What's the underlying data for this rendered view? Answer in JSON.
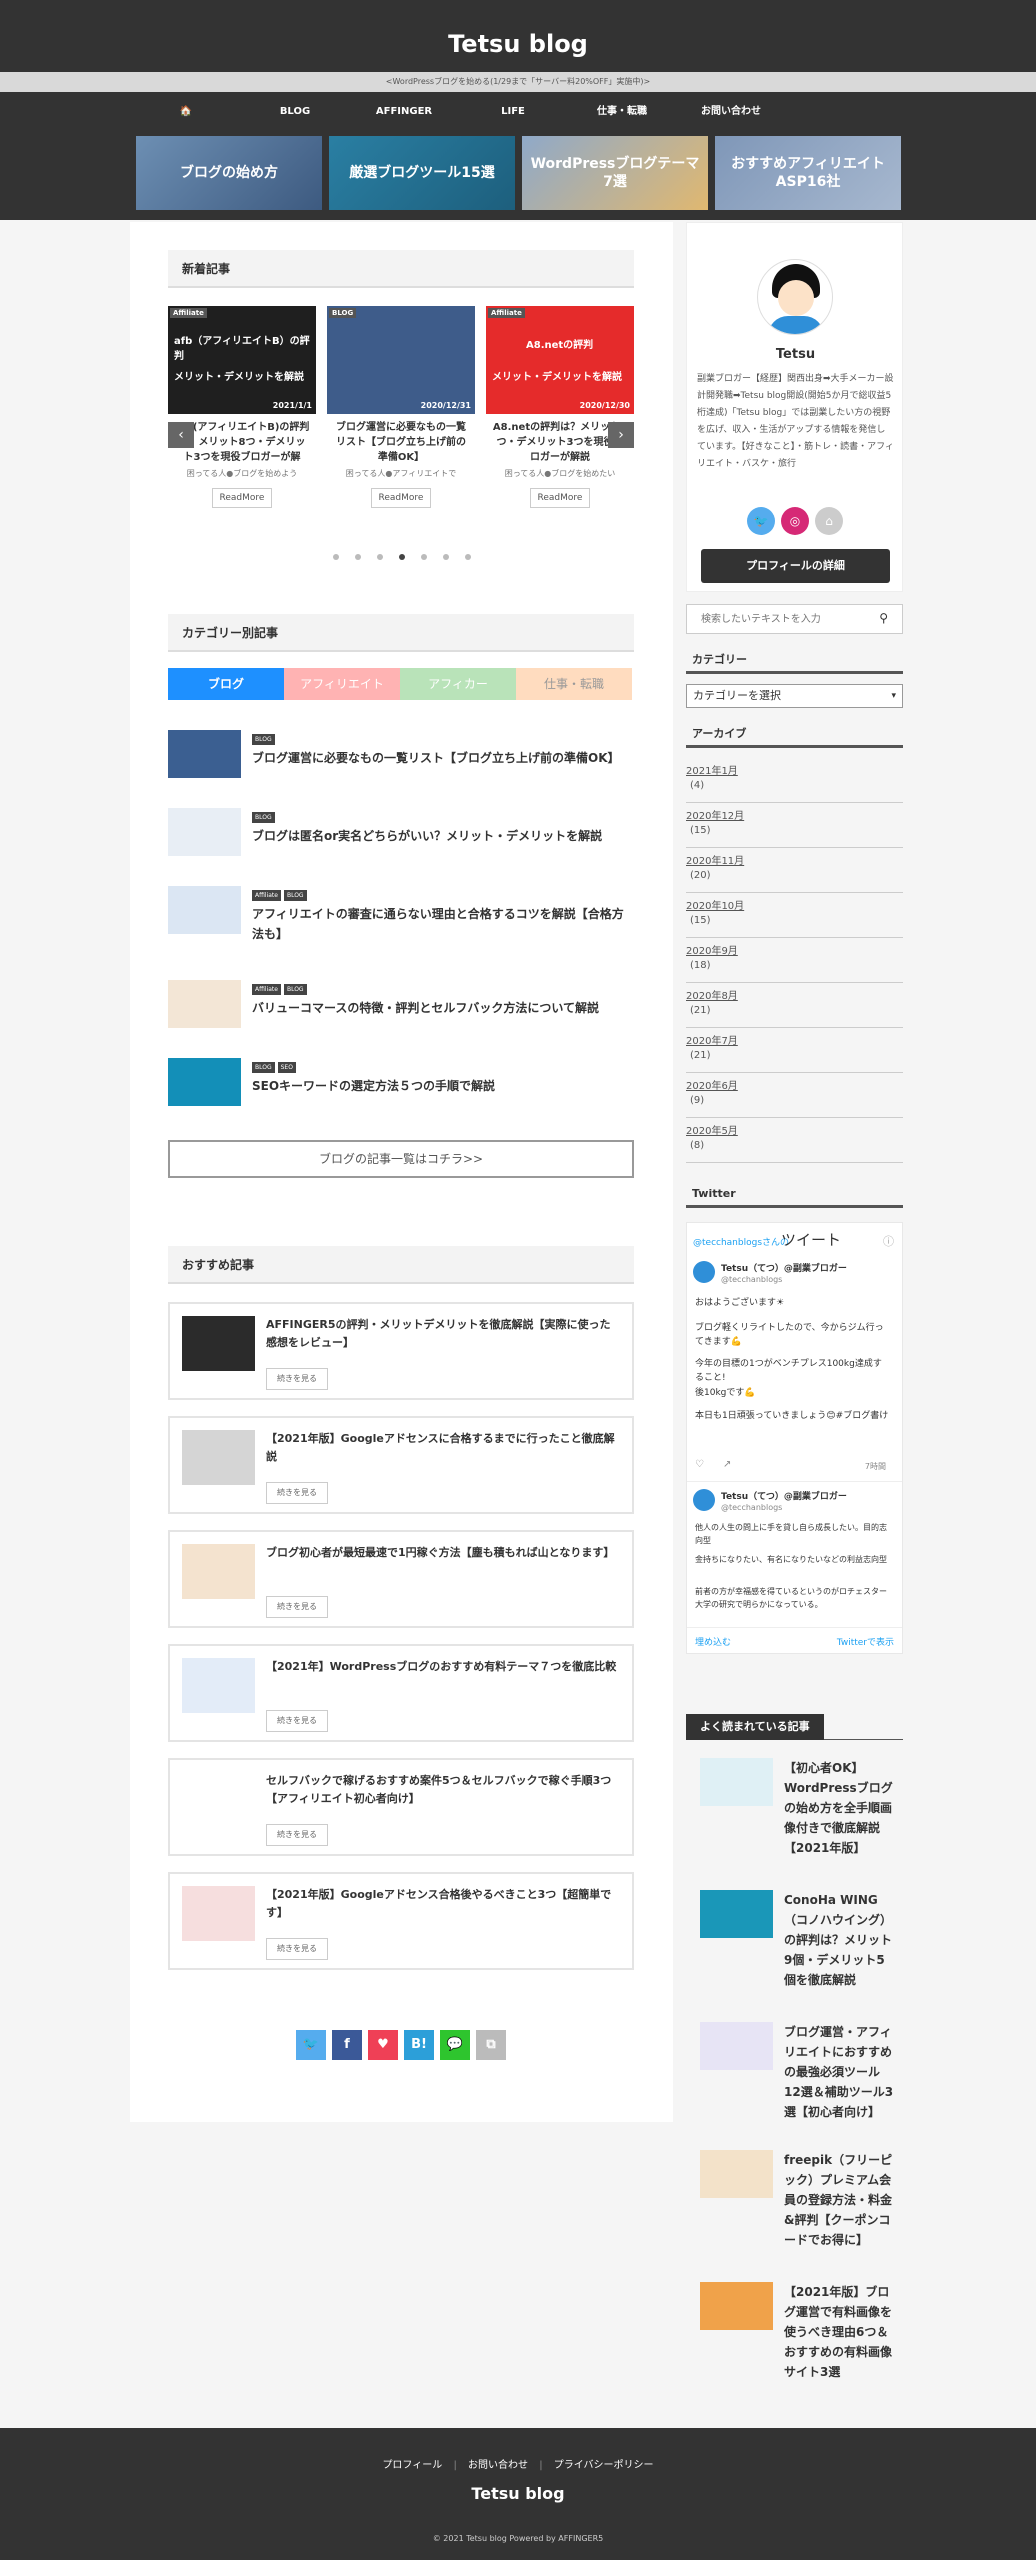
{
  "header": {
    "site_title": "Tetsu blog",
    "announcement": "<WordPressブログを始める(1/29まで「サーバー料20%OFF」実施中)>"
  },
  "nav": {
    "items": [
      {
        "label": "🏠",
        "icon": "home-icon"
      },
      {
        "label": "BLOG"
      },
      {
        "label": "AFFINGER"
      },
      {
        "label": "LIFE"
      },
      {
        "label": "仕事・転職"
      },
      {
        "label": "お問い合わせ"
      }
    ]
  },
  "banners": [
    {
      "label": "ブログの始め方"
    },
    {
      "label": "厳選ブログツール15選"
    },
    {
      "label": "WordPressブログテーマ7選"
    },
    {
      "label": "おすすめアフィリエイトASP16社"
    }
  ],
  "new_posts": {
    "heading": "新着記事",
    "cards": [
      {
        "tag": "Affiliate",
        "overlay_brand": "afb（アフィリエイトB）の評判",
        "overlay": "メリット・デメリットを解説",
        "date": "2021/1/1",
        "title": "afb(アフィリエイトB)の評判は？メリット8つ・デメリット3つを現役ブロガーが解",
        "excerpt": "困ってる人●ブログを始めよう",
        "readmore": "ReadMore"
      },
      {
        "tag": "BLOG",
        "overlay": "",
        "date": "2020/12/31",
        "title": "ブログ運営に必要なもの一覧リスト【ブログ立ち上げ前の準備OK】",
        "excerpt": "困ってる人●アフィリエイトで",
        "readmore": "ReadMore"
      },
      {
        "tag": "Affiliate",
        "overlay_brand": "A8.netの評判",
        "overlay": "メリット・デメリットを解説",
        "date": "2020/12/30",
        "title": "A8.netの評判は？メリット8つ・デメリット3つを現役ブロガーが解説",
        "excerpt": "困ってる人●ブログを始めたい",
        "readmore": "ReadMore"
      }
    ]
  },
  "category_posts": {
    "heading": "カテゴリー別記事",
    "tabs": [
      {
        "label": "ブログ",
        "color": "#1e90ff"
      },
      {
        "label": "アフィリエイト",
        "color": "#ffb3b3"
      },
      {
        "label": "アフィカー",
        "color": "#b9e3b9"
      },
      {
        "label": "仕事・転職",
        "color": "#ffdcbf"
      }
    ],
    "items": [
      {
        "tags": [
          "BLOG"
        ],
        "title": "ブログ運営に必要なもの一覧リスト【ブログ立ち上げ前の準備OK】"
      },
      {
        "tags": [
          "BLOG"
        ],
        "title": "ブログは匿名or実名どちらがいい？メリット・デメリットを解説"
      },
      {
        "tags": [
          "Affiliate",
          "BLOG"
        ],
        "title": "アフィリエイトの審査に通らない理由と合格するコツを解説【合格方法も】"
      },
      {
        "tags": [
          "Affiliate",
          "BLOG"
        ],
        "title": "バリューコマースの特徴・評判とセルフバック方法について解説"
      },
      {
        "tags": [
          "BLOG",
          "SEO"
        ],
        "title": "SEOキーワードの選定方法５つの手順で解説"
      }
    ],
    "more_button": "ブログの記事一覧はコチラ>>"
  },
  "recommended": {
    "heading": "おすすめ記事",
    "button": "続きを見る",
    "items": [
      {
        "title": "AFFINGER5の評判・メリットデメリットを徹底解説【実際に使った感想をレビュー】"
      },
      {
        "title": "【2021年版】Googleアドセンスに合格するまでに行ったこと徹底解説"
      },
      {
        "title": "ブログ初心者が最短最速で1円稼ぐ方法【塵も積もれば山となります】"
      },
      {
        "title": "【2021年】WordPressブログのおすすめ有料テーマ７つを徹底比較"
      },
      {
        "title": "セルフバックで稼げるおすすめ案件5つ＆セルフバックで稼ぐ手順3つ【アフィリエイト初心者向け】"
      },
      {
        "title": "【2021年版】Googleアドセンス合格後やるべきこと3つ【超簡単です】"
      }
    ]
  },
  "share": [
    {
      "label": "🐦",
      "icon": "twitter-icon",
      "color": "#55acee"
    },
    {
      "label": "f",
      "icon": "facebook-icon",
      "color": "#3b5998"
    },
    {
      "label": "♥",
      "icon": "pocket-icon",
      "color": "#ef4056"
    },
    {
      "label": "B!",
      "icon": "hatena-icon",
      "color": "#2c9fd9"
    },
    {
      "label": "💬",
      "icon": "line-icon",
      "color": "#2ec52e"
    },
    {
      "label": "⧉",
      "icon": "copy-icon",
      "color": "#bbbbbb"
    }
  ],
  "profile": {
    "name": "Tetsu",
    "bio": "副業ブロガー【経歴】関西出身➡大手メーカー設計開発職➡Tetsu blog開設(開始5か月で総収益5桁達成)「Tetsu blog」では副業したい方の視野を広げ、収入・生活がアップする情報を発信しています。【好きなこと】・筋トレ・読書・アフィリエイト・バスケ・旅行",
    "button": "プロフィールの詳細"
  },
  "search": {
    "placeholder": "検索したいテキストを入力"
  },
  "categories": {
    "title": "カテゴリー",
    "select": "カテゴリーを選択"
  },
  "archive": {
    "title": "アーカイブ",
    "items": [
      {
        "month": "2021年1月",
        "count": "(4)"
      },
      {
        "month": "2020年12月",
        "count": "(15)"
      },
      {
        "month": "2020年11月",
        "count": "(20)"
      },
      {
        "month": "2020年10月",
        "count": "(15)"
      },
      {
        "month": "2020年9月",
        "count": "(18)"
      },
      {
        "month": "2020年8月",
        "count": "(21)"
      },
      {
        "month": "2020年7月",
        "count": "(21)"
      },
      {
        "month": "2020年6月",
        "count": "(9)"
      },
      {
        "month": "2020年5月",
        "count": "(8)"
      }
    ]
  },
  "twitter": {
    "title": "Twitter",
    "header_user": "@tecchanblogsさんの",
    "header_label": "ツイート",
    "tweet1": {
      "name": "Tetsu（てつ）@副業ブロガー",
      "handle": "@tecchanblogs",
      "lines": [
        "おはようございます☀",
        "ブログ軽くリライトしたので、今からジム行ってきます💪",
        "今年の目標の1つがベンチプレス100kg達成すること!",
        "後10kgです💪",
        "本日も1日頑張っていきましょう😊#ブログ書け"
      ],
      "time": "7時間"
    },
    "tweet2": {
      "name": "Tetsu（てつ）@副業ブロガー",
      "handle": "@tecchanblogs",
      "lines": [
        "他人の人生の問上に手を貸し自ら成長したい。目的志向型",
        "金持ちになりたい、有名になりたいなどの利益志向型",
        "前者の方が幸福感を得ているというのがロチェスター大学の研究で明らかになっている。"
      ]
    },
    "embed": "埋め込む",
    "view": "Twitterで表示"
  },
  "popular": {
    "title": "よく読まれている記事",
    "items": [
      {
        "title": "【初心者OK】WordPressブログの始め方を全手順画像付きで徹底解説【2021年版】"
      },
      {
        "title": "ConoHa WING（コノハウイング）の評判は？メリット9個・デメリット5個を徹底解説"
      },
      {
        "title": "ブログ運営・アフィリエイトにおすすめの最強必須ツール12選＆補助ツール3選【初心者向け】"
      },
      {
        "title": "freepik（フリーピック）プレミアム会員の登録方法・料金&評判【クーポンコードでお得に】"
      },
      {
        "title": "【2021年版】ブログ運営で有料画像を使うべき理由6つ＆おすすめの有料画像サイト3選"
      }
    ]
  },
  "footer": {
    "links": [
      "プロフィール",
      "お問い合わせ",
      "プライバシーポリシー"
    ],
    "title": "Tetsu blog",
    "copyright": "© 2021 Tetsu blog Powered by AFFINGER5"
  }
}
